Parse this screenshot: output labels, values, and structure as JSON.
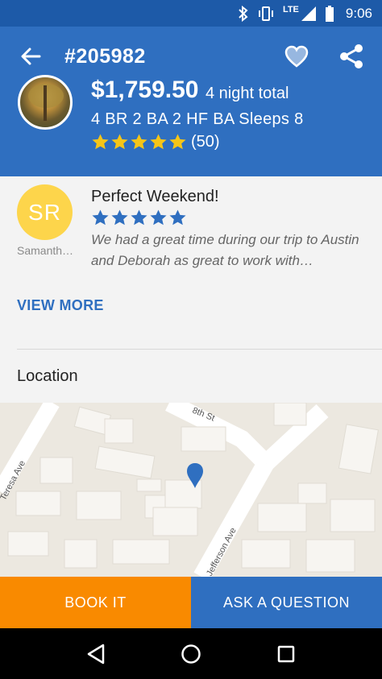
{
  "status_bar": {
    "network_label": "LTE",
    "time": "9:06",
    "icons": [
      "bluetooth-icon",
      "vibrate-icon",
      "signal-icon",
      "battery-icon"
    ]
  },
  "header": {
    "listing_id": "#205982",
    "price": "$1,759.50",
    "price_note": "4 night total",
    "details": "4 BR 2 BA 2 HF BA Sleeps 8",
    "rating_stars": 5,
    "review_count": "(50)",
    "icons": {
      "back": "back-arrow-icon",
      "favorite": "heart-icon",
      "share": "share-icon"
    }
  },
  "review": {
    "avatar_initials": "SR",
    "reviewer_name": "Samanth…",
    "title": "Perfect Weekend!",
    "stars": 5,
    "body": "We had a great time during our trip to Austin and Deborah as great to work with…",
    "view_more_label": "VIEW MORE"
  },
  "location": {
    "label": "Location",
    "map_street_labels": [
      "8th St",
      "Teresa Ave",
      "Jefferson Ave"
    ]
  },
  "actions": {
    "book_label": "BOOK IT",
    "ask_label": "ASK A QUESTION"
  },
  "colors": {
    "header_blue": "#2f6fc0",
    "status_blue": "#1d5aa8",
    "star_yellow": "#f5c518",
    "review_star_blue": "#2f6fc0",
    "book_orange": "#f98a00",
    "avatar_yellow": "#fdd54b"
  },
  "nav": {
    "icons": [
      "back-triangle-icon",
      "home-circle-icon",
      "recents-square-icon"
    ]
  }
}
